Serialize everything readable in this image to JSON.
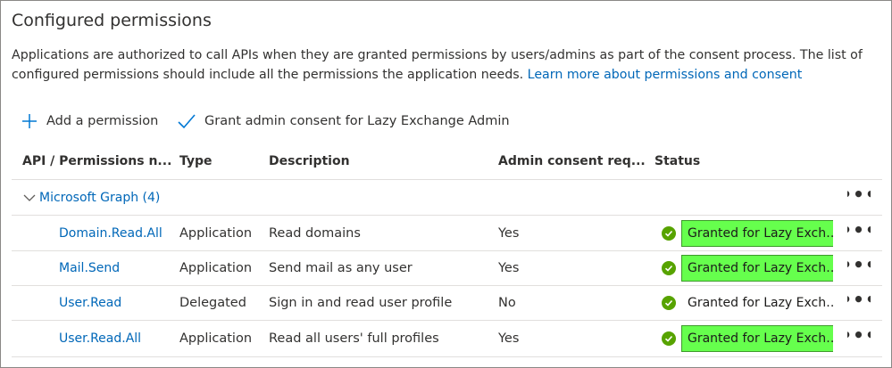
{
  "section": {
    "title": "Configured permissions",
    "description": "Applications are authorized to call APIs when they are granted permissions by users/admins as part of the consent process. The list of configured permissions should include all the permissions the application needs.",
    "learn_more_link": "Learn more about permissions and consent"
  },
  "toolbar": {
    "add_permission_label": "Add a permission",
    "grant_consent_label": "Grant admin consent for Lazy Exchange Admin"
  },
  "table": {
    "columns": {
      "api": "API / Permissions n...",
      "type": "Type",
      "description": "Description",
      "admin_consent": "Admin consent req...",
      "status": "Status"
    },
    "group": {
      "label": "Microsoft Graph (4)",
      "more": "•••"
    },
    "rows": [
      {
        "name": "Domain.Read.All",
        "type": "Application",
        "description": "Read domains",
        "admin_consent": "Yes",
        "status": "Granted for Lazy Exchange Admin",
        "highlighted": true,
        "more": "•••"
      },
      {
        "name": "Mail.Send",
        "type": "Application",
        "description": "Send mail as any user",
        "admin_consent": "Yes",
        "status": "Granted for Lazy Exchange Admin",
        "highlighted": true,
        "more": "•••"
      },
      {
        "name": "User.Read",
        "type": "Delegated",
        "description": "Sign in and read user profile",
        "admin_consent": "No",
        "status": "Granted for Lazy Exchange Admin",
        "highlighted": false,
        "more": "•••"
      },
      {
        "name": "User.Read.All",
        "type": "Application",
        "description": "Read all users' full profiles",
        "admin_consent": "Yes",
        "status": "Granted for Lazy Exchange Admin",
        "highlighted": true,
        "more": "•••"
      }
    ]
  },
  "colors": {
    "link": "#0067b8",
    "success": "#57a300",
    "highlight": "#66ff4d"
  }
}
